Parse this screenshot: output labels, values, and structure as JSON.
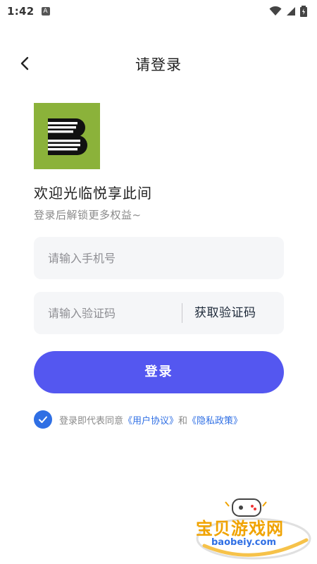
{
  "status_bar": {
    "time": "1:42"
  },
  "header": {
    "title": "请登录"
  },
  "welcome": {
    "title": "欢迎光临悦享此间",
    "subtitle": "登录后解锁更多权益~"
  },
  "form": {
    "phone_placeholder": "请输入手机号",
    "phone_value": "",
    "code_placeholder": "请输入验证码",
    "code_value": "",
    "get_code_label": "获取验证码"
  },
  "login_button": {
    "label": "登录"
  },
  "agreement": {
    "checked": true,
    "prefix": "登录即代表同意",
    "user_agreement": "《用户协议》",
    "and": "和",
    "privacy_policy": "《隐私政策》"
  },
  "watermark": {
    "title": "宝贝游戏网",
    "url": "baobeiy.com"
  },
  "colors": {
    "accent": "#5457f0",
    "link": "#2f6fe4",
    "logo_bg": "#8bb23a",
    "input_bg": "#f5f6f8"
  }
}
